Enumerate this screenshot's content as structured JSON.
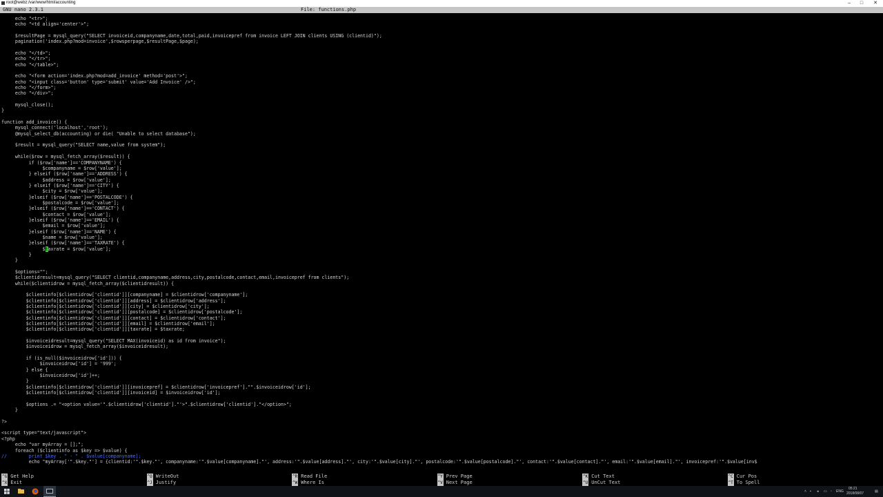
{
  "window": {
    "title": "root@webz:/var/www/html/accounting",
    "minimize_glyph": "–",
    "maximize_glyph": "□",
    "close_glyph": "✕"
  },
  "nano_header": {
    "version": "GNU nano 2.3.1",
    "file": "File: functions.php"
  },
  "code_lines": [
    "     echo \"<tr>\";",
    "     echo \"<td align='center'>\";",
    "",
    "     $resultPage = mysql_query(\"SELECT invoiceid,companyname,date,total,paid,invoicepref from invoice LEFT JOIN clients USING (clientid)\");",
    "     pagination('index.php?mod=invoice',$rowsperpage,$resultPage,$page);",
    "",
    "     echo \"</td>\";",
    "     echo \"</tr>\";",
    "     echo \"</table>\";",
    "",
    "     echo \"<form action='index.php?mod=add_invoice' method='post'>\";",
    "     echo \"<input class='button' type='submit' value='Add Invoice' />\";",
    "     echo \"</form>\";",
    "     echo \"</div>\";",
    "",
    "     mysql_close();",
    "}",
    "",
    "function add_invoice() {",
    "     mysql_connect('localhost','root');",
    "     @mysql_select_db(accounting) or die( \"Unable to select database\");",
    "",
    "     $result = mysql_query(\"SELECT name,value from system\");",
    "",
    "     while($row = mysql_fetch_array($result)) {",
    "          if ($row['name']=='COMPANYNAME') {",
    "               $companyname = $row['value'];",
    "          } elseif ($row['name']=='ADDRESS') {",
    "               $address = $row['value'];",
    "          } elseif ($row['name']=='CITY') {",
    "               $city = $row['value'];",
    "          }elseif ($row['name']=='POSTALCODE') {",
    "               $postalcode = $row['value'];",
    "          }elseif ($row['name']=='CONTACT') {",
    "               $contact = $row['value'];",
    "          }elseif ($row['name']=='EMAIL') {",
    "               $email = $row['value'];",
    "          }elseif ($row['name']=='NAME') {",
    "               $name = $row['value'];",
    "          }elseif ($row['name']=='TAXRATE') {",
    "               $taxrate = $row['value'];",
    "          }",
    "     }",
    "",
    "     $options=\"\";",
    "     $clientidresult=mysql_query(\"SELECT clientid,companyname,address,city,postalcode,contact,email,invoicepref from clients\");",
    "     while($clientidrow = mysql_fetch_array($clientidresult)) {",
    "",
    "         $clientinfo[$clientidrow['clientid']][companyname] = $clientidrow['companyname'];",
    "         $clientinfo[$clientidrow['clientid']][address] = $clientidrow['address'];",
    "         $clientinfo[$clientidrow['clientid']][city] = $clientidrow['city'];",
    "         $clientinfo[$clientidrow['clientid']][postalcode] = $clientidrow['postalcode'];",
    "         $clientinfo[$clientidrow['clientid']][contact] = $clientidrow['contact'];",
    "         $clientinfo[$clientidrow['clientid']][email] = $clientidrow['email'];",
    "         $clientinfo[$clientidrow['clientid']][taxrate] = $taxrate;",
    "",
    "         $invoiceidresult=mysql_query(\"SELECT MAX(invoiceid) as id from invoice\");",
    "         $invoiceidrow = mysql_fetch_array($invoiceidresult);",
    "",
    "         if (is_null($invoiceidrow['id'])) {",
    "              $invoiceidrow['id'] = '999';",
    "         } else {",
    "              $invoiceidrow['id']++;",
    "         }",
    "         $clientinfo[$clientidrow['clientid']][invoicepref] = $clientidrow['invoicepref'].\"\".$invoiceidrow['id'];",
    "         $clientinfo[$clientidrow['clientid']][invoiceid] = $invoiceidrow['id'];",
    "",
    "         $options .= \"<option value='\".$clientidrow['clientid'].\"'>\".$clientidrow['clientid'].\"</option>\";",
    "     }",
    "",
    "?>",
    "",
    "<script type=\"text/javascript\">",
    "<?php",
    "     echo \"var myArray = [];\";",
    "     foreach ($clientinfo as $key => $value) {",
    "//        print $key . \" - \" . $value[companyname];",
    "          echo \"myArray['\".$key.\"'] = {clientid:'\".$key.\"', companyname:'\".$value[companyname].\"', address:'\".$value[address].\"', city:'\".$value[city].\"', postalcode:'\".$value[postalcode].\"', contact:'\".$value[contact].\"', email:'\".$value[email].\"', invoicepref:'\".$value[inv$"
  ],
  "cursor": {
    "line_index": 40,
    "col": 16,
    "color": "#39c93d"
  },
  "shortcuts": [
    {
      "key": "^G",
      "label": "Get Help"
    },
    {
      "key": "^X",
      "label": "Exit"
    },
    {
      "key": "^O",
      "label": "WriteOut"
    },
    {
      "key": "^J",
      "label": "Justify"
    },
    {
      "key": "^R",
      "label": "Read File"
    },
    {
      "key": "^W",
      "label": "Where Is"
    },
    {
      "key": "^Y",
      "label": "Prev Page"
    },
    {
      "key": "^V",
      "label": "Next Page"
    },
    {
      "key": "^K",
      "label": "Cut Text"
    },
    {
      "key": "^U",
      "label": "UnCut Text"
    },
    {
      "key": "^C",
      "label": "Cur Pos"
    },
    {
      "key": "^T",
      "label": "To Spell"
    }
  ],
  "taskbar": {
    "start_icon": "windows-start-icon",
    "pinned": [
      "file-explorer-icon",
      "firefox-icon",
      "putty-terminal-icon"
    ],
    "tray_lang": "ENG",
    "tray_time": "05:21",
    "tray_date": "2018/08/07"
  },
  "colors": {
    "header_bg": "#c6c6c6",
    "text": "#d4d4d4",
    "comment": "#4a6cff",
    "taskbar": "#101418"
  }
}
